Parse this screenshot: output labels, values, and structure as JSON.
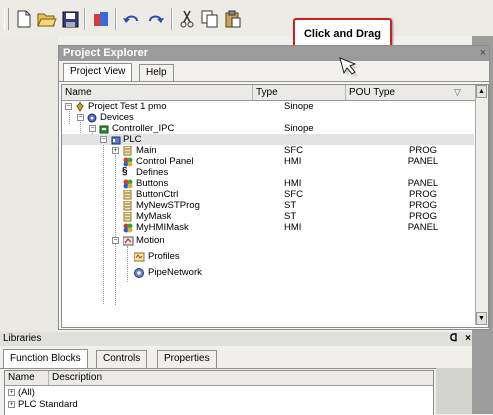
{
  "toolbar": {
    "icons": [
      "new-file-icon",
      "open-folder-icon",
      "save-icon",
      "project-icon",
      "undo-icon",
      "redo-icon",
      "cut-icon",
      "copy-icon",
      "paste-icon"
    ],
    "callout_text": "Click and Drag"
  },
  "project_explorer": {
    "title": "Project Explorer",
    "close": "×",
    "tabs": [
      "Project View",
      "Help"
    ],
    "columns": [
      "Name",
      "Type",
      "POU Type"
    ],
    "rows": [
      {
        "name": "Project Test 1 pmo",
        "type": "Sinope",
        "pou": ""
      },
      {
        "name": "Devices",
        "type": "",
        "pou": ""
      },
      {
        "name": "Controller_IPC",
        "type": "Sinope",
        "pou": ""
      },
      {
        "name": "PLC",
        "type": "",
        "pou": ""
      },
      {
        "name": "Main",
        "type": "SFC",
        "pou": "PROG"
      },
      {
        "name": "Control Panel",
        "type": "HMI",
        "pou": "PANEL"
      },
      {
        "name": "Defines",
        "type": "",
        "pou": ""
      },
      {
        "name": "Buttons",
        "type": "HMI",
        "pou": "PANEL"
      },
      {
        "name": "ButtonCtrl",
        "type": "SFC",
        "pou": "PROG"
      },
      {
        "name": "MyNewSTProg",
        "type": "ST",
        "pou": "PROG"
      },
      {
        "name": "MyMask",
        "type": "ST",
        "pou": "PROG"
      },
      {
        "name": "MyHMIMask",
        "type": "HMI",
        "pou": "PANEL"
      },
      {
        "name": "Motion",
        "type": "",
        "pou": ""
      },
      {
        "name": "Profiles",
        "type": "",
        "pou": ""
      },
      {
        "name": "PipeNetwork",
        "type": "",
        "pou": ""
      }
    ]
  },
  "libraries": {
    "title": "Libraries",
    "pin": "ᗡ",
    "close": "×",
    "tabs": [
      "Function Blocks",
      "Controls",
      "Properties"
    ],
    "columns": [
      "Name",
      "Description"
    ],
    "rows": [
      "(All)",
      "PLC Standard"
    ]
  }
}
